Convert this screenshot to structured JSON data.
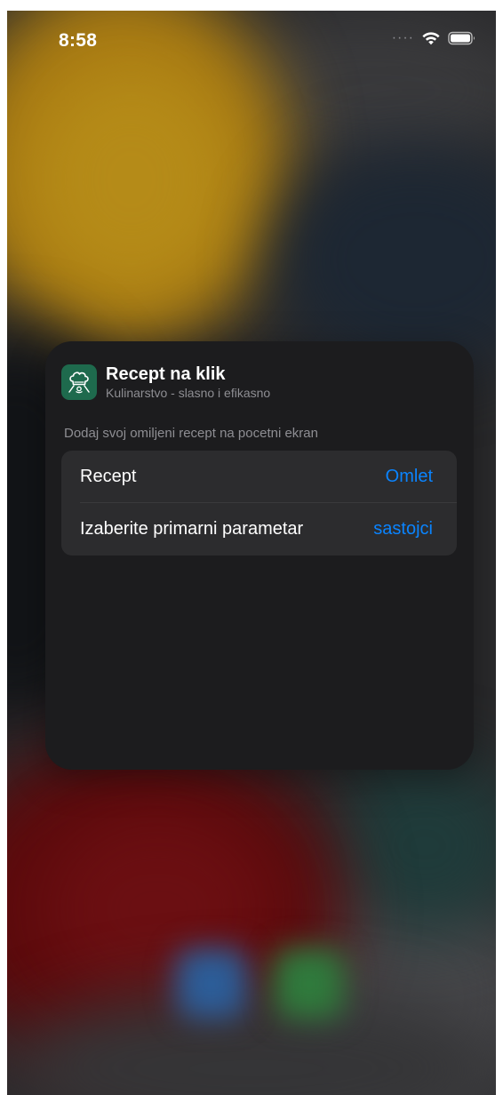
{
  "status_bar": {
    "time": "8:58",
    "signal_icon": "cellular-signal-dots-icon",
    "wifi_icon": "wifi-icon",
    "battery_icon": "battery-icon"
  },
  "widget": {
    "app_icon": "chef-hat-icon",
    "app_name": "Recept na klik",
    "app_description": "Kulinarstvo - slasno i efikasno",
    "section_header": "Dodaj svoj omiljeni recept na pocetni ekran",
    "parameters": [
      {
        "label": "Recept",
        "value": "Omlet"
      },
      {
        "label": "Izaberite primarni parametar",
        "value": "sastojci"
      }
    ]
  },
  "colors": {
    "accent": "#0a84ff",
    "sheet_background": "#1c1c1e",
    "card_background": "#2c2c2e",
    "app_icon_background": "#1e6a4d"
  }
}
